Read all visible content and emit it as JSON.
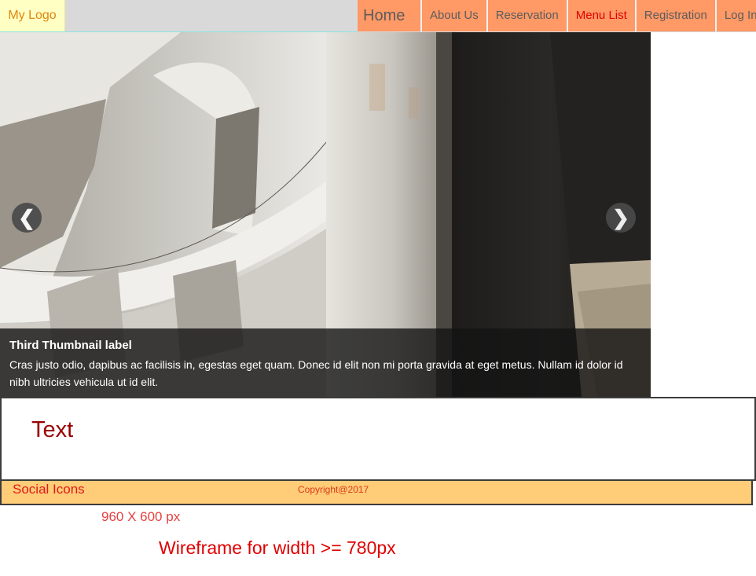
{
  "header": {
    "logo": "My Logo",
    "nav": {
      "home": "Home",
      "about": "About Us",
      "reservation": "Reservation",
      "menu_list": "Menu List",
      "registration": "Registration",
      "login": "Log In"
    },
    "active_item": "Menu List"
  },
  "carousel": {
    "prev_glyph": "❮",
    "next_glyph": "❯",
    "caption_title": "Third Thumbnail label",
    "caption_text": "Cras justo odio, dapibus ac facilisis in, egestas eget quam. Donec id elit non mi porta gravida at eget metus. Nullam id dolor id nibh ultricies vehicula ut id elit."
  },
  "text_section": {
    "label": "Text"
  },
  "footer": {
    "social": "Social Icons",
    "copyright": "Copyright@2017"
  },
  "annotations": {
    "size": "960 X 600 px",
    "wireframe": "Wireframe for width >= 780px"
  },
  "colors": {
    "nav_bg": "#ff9966",
    "logo_bg": "#ffffc4",
    "footer_bg": "#ffcc77",
    "accent_red": "#e00000"
  }
}
